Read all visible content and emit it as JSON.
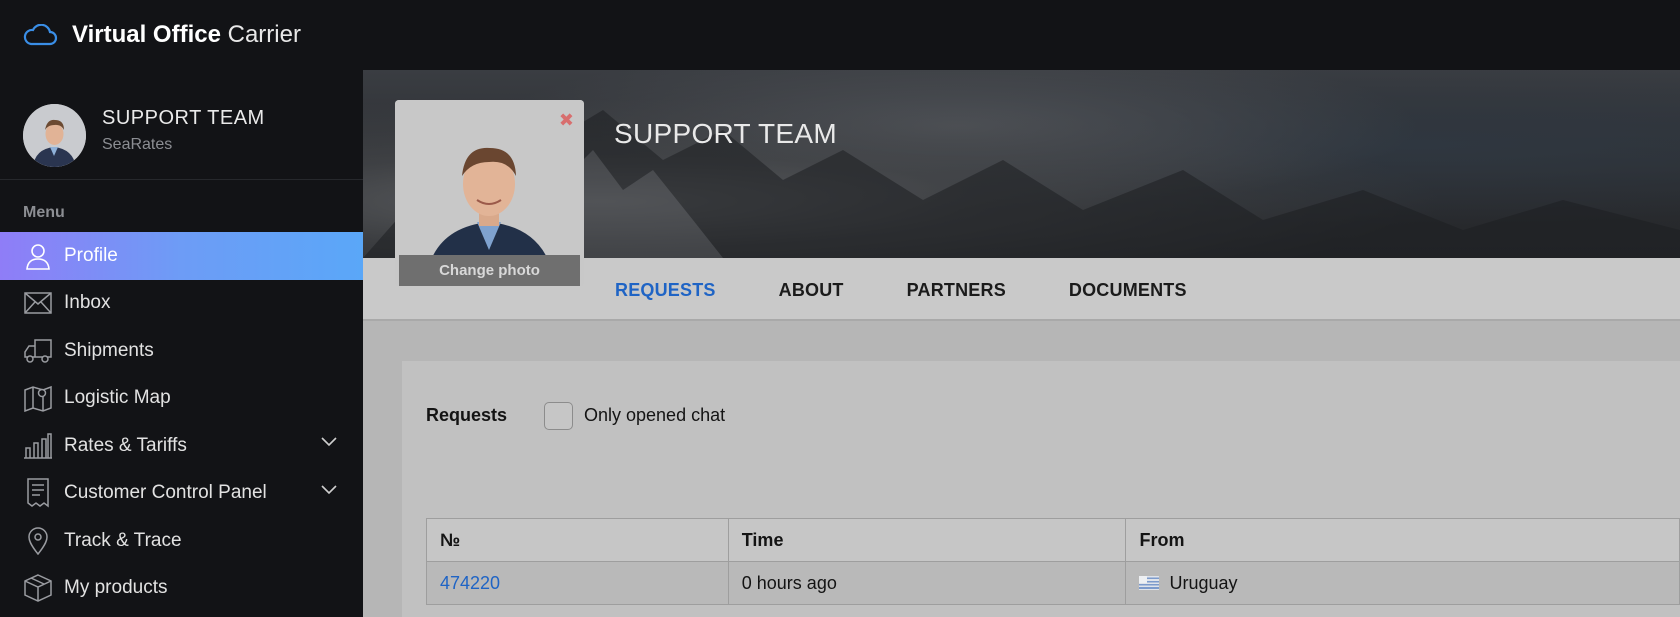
{
  "app": {
    "brand_bold": "Virtual Office",
    "brand_light": "Carrier"
  },
  "user": {
    "name": "SUPPORT TEAM",
    "company": "SeaRates"
  },
  "menu": {
    "title": "Menu",
    "items": [
      {
        "label": "Profile",
        "icon": "user-icon",
        "active": true
      },
      {
        "label": "Inbox",
        "icon": "mail-icon"
      },
      {
        "label": "Shipments",
        "icon": "truck-icon"
      },
      {
        "label": "Logistic Map",
        "icon": "map-pin-icon"
      },
      {
        "label": "Rates & Tariffs",
        "icon": "bar-chart-icon",
        "expandable": true
      },
      {
        "label": "Customer Control Panel",
        "icon": "receipt-icon",
        "expandable": true
      },
      {
        "label": "Track & Trace",
        "icon": "location-icon"
      },
      {
        "label": "My products",
        "icon": "box-icon"
      }
    ]
  },
  "profile": {
    "title": "SUPPORT TEAM",
    "change_photo": "Change photo",
    "close_symbol": "✖"
  },
  "tabs": [
    {
      "label": "REQUESTS",
      "active": true
    },
    {
      "label": "ABOUT"
    },
    {
      "label": "PARTNERS"
    },
    {
      "label": "DOCUMENTS"
    }
  ],
  "requests": {
    "label": "Requests",
    "filter_label": "Only opened chat",
    "columns": [
      "№",
      "Time",
      "From"
    ],
    "rows": [
      {
        "number": "474220",
        "time": "0 hours ago",
        "from": "Uruguay"
      }
    ]
  },
  "colors": {
    "accent": "#1f64c5",
    "active_gradient_start": "#8f7df7",
    "active_gradient_end": "#5aa7f8",
    "close": "#d86e6e"
  }
}
